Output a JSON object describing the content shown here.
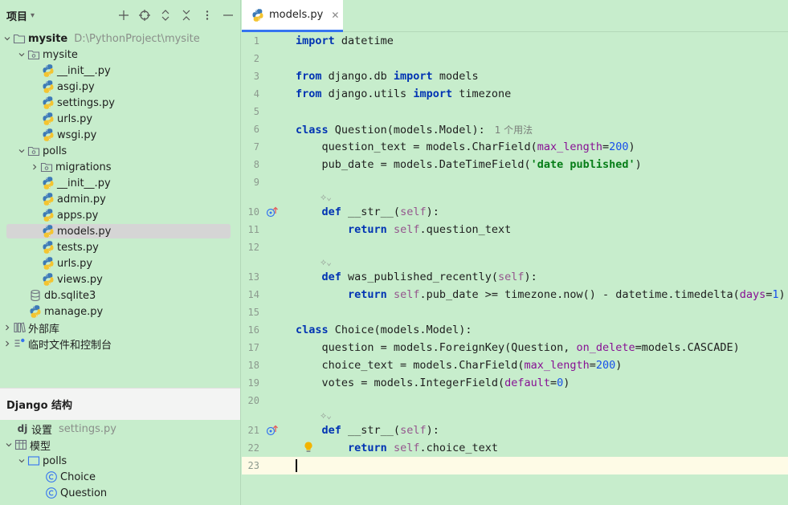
{
  "project_panel": {
    "title": "项目",
    "tree": {
      "root": {
        "name": "mysite",
        "path": "D:\\PythonProject\\mysite"
      },
      "mysite_pkg": {
        "name": "mysite",
        "files": [
          "__init__.py",
          "asgi.py",
          "settings.py",
          "urls.py",
          "wsgi.py"
        ]
      },
      "polls_pkg": {
        "name": "polls",
        "migrations": "migrations",
        "files": [
          "__init__.py",
          "admin.py",
          "apps.py",
          "models.py",
          "tests.py",
          "urls.py",
          "views.py"
        ],
        "selected_file": "models.py"
      },
      "db_file": "db.sqlite3",
      "manage_file": "manage.py",
      "external_libs": "外部库",
      "scratches": "临时文件和控制台"
    }
  },
  "django_panel": {
    "title": "Django 结构",
    "settings_label": "设置",
    "settings_file": "settings.py",
    "models_label": "模型",
    "app_name": "polls",
    "models": [
      "Choice",
      "Question"
    ]
  },
  "editor": {
    "tab_label": "models.py",
    "line_numbers": [
      "1",
      "2",
      "3",
      "4",
      "5",
      "6",
      "7",
      "8",
      "9",
      "10",
      "11",
      "12",
      "13",
      "14",
      "15",
      "16",
      "17",
      "18",
      "19",
      "20",
      "21",
      "22",
      "23"
    ],
    "usage_hint": "1 个用法",
    "code": {
      "l1_kw": "import",
      "l1_mod": " datetime",
      "l3_kw1": "from",
      "l3_mod": " django.db ",
      "l3_kw2": "import",
      "l3_name": " models",
      "l4_kw1": "from",
      "l4_mod": " django.utils ",
      "l4_kw2": "import",
      "l4_name": " timezone",
      "l6_kw": "class",
      "l6_rest": " Question(models.Model):",
      "l7_a": "    question_text = models.CharField(",
      "l7_p": "max_length",
      "l7_eq": "=",
      "l7_n": "200",
      "l7_c": ")",
      "l8_a": "    pub_date = models.DateTimeField(",
      "l8_s": "'date published'",
      "l8_c": ")",
      "l10_indent": "    ",
      "l10_kw": "def",
      "l10_name": " __str__(",
      "l10_self": "self",
      "l10_end": "):",
      "l11_indent": "        ",
      "l11_kw": "return",
      "l11_sp": " ",
      "l11_self": "self",
      "l11_rest": ".question_text",
      "l13_indent": "    ",
      "l13_kw": "def",
      "l13_name": " was_published_recently(",
      "l13_self": "self",
      "l13_end": "):",
      "l14_indent": "        ",
      "l14_kw": "return",
      "l14_sp": " ",
      "l14_self": "self",
      "l14_rest": ".pub_date >= timezone.now() - datetime.timedelta(",
      "l14_p": "days",
      "l14_eq": "=",
      "l14_n": "1",
      "l14_c": ")",
      "l16_kw": "class",
      "l16_rest": " Choice(models.Model):",
      "l17_a": "    question = models.ForeignKey(Question, ",
      "l17_p": "on_delete",
      "l17_rest": "=models.CASCADE)",
      "l18_a": "    choice_text = models.CharField(",
      "l18_p": "max_length",
      "l18_eq": "=",
      "l18_n": "200",
      "l18_c": ")",
      "l19_a": "    votes = models.IntegerField(",
      "l19_p": "default",
      "l19_eq": "=",
      "l19_n": "0",
      "l19_c": ")",
      "l21_indent": "    ",
      "l21_kw": "def",
      "l21_name": " __str__(",
      "l21_self": "self",
      "l21_end": "):",
      "l22_indent": "        ",
      "l22_kw": "return",
      "l22_sp": " ",
      "l22_self": "self",
      "l22_rest": ".choice_text"
    }
  },
  "colors": {
    "background": "#c7edcc",
    "keyword": "#0033b3",
    "self": "#94558d",
    "parameter": "#871094",
    "number": "#1750eb",
    "string": "#067d17",
    "tab_underline": "#3574f0",
    "current_line": "#fefbe6",
    "selected_row": "#d5d5d5"
  },
  "icons": {
    "python_file": "python-file-icon",
    "folder": "folder-icon",
    "package_folder": "package-folder-icon",
    "database": "database-icon",
    "library": "library-icon",
    "scratches": "scratches-icon",
    "override_method": "override-method-icon",
    "intention_bulb": "lightbulb-icon",
    "django": "django-icon",
    "model_class": "class-icon"
  }
}
